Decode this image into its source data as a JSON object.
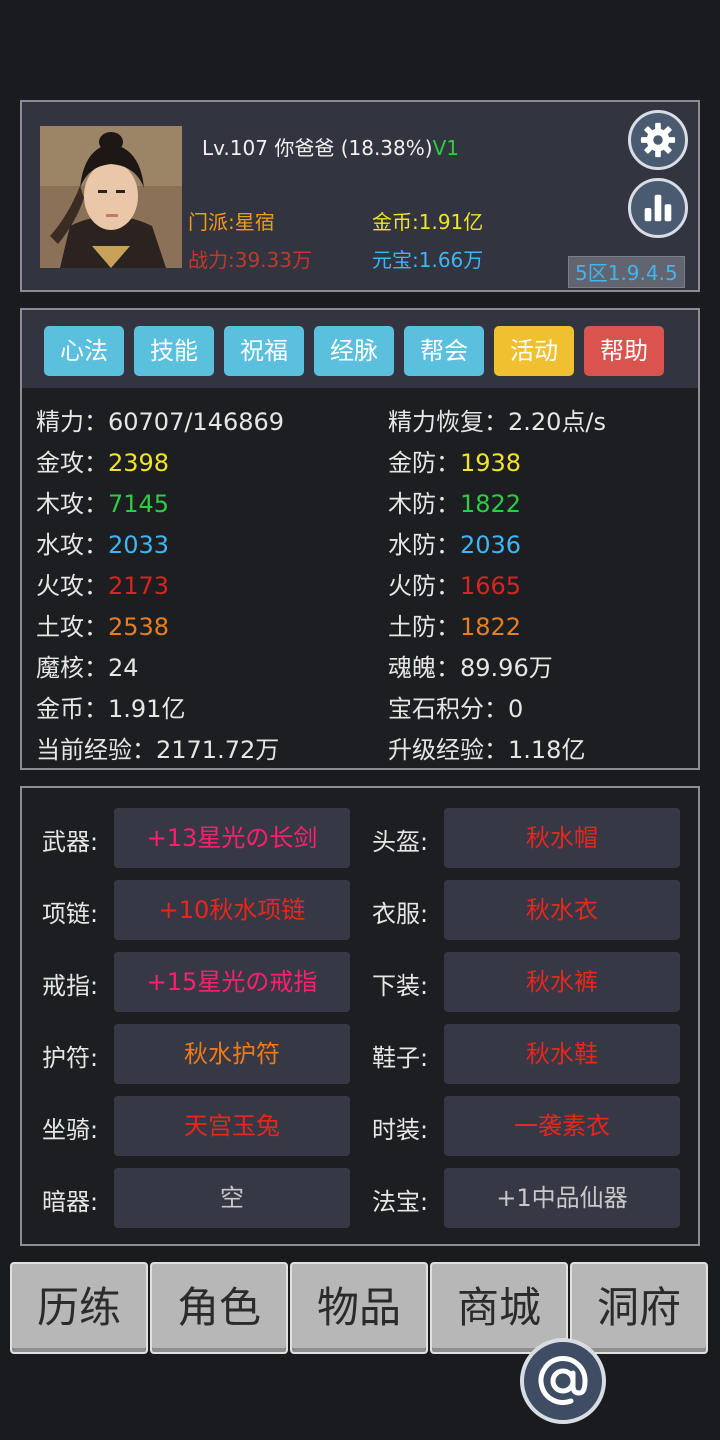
{
  "player": {
    "level": "Lv.107",
    "name": "你爸爸",
    "progress": "(18.38%)",
    "vip": "V1",
    "sect": "门派:星宿",
    "power": "战力:39.33万",
    "gold": "金币:1.91亿",
    "ingot": "元宝:1.66万",
    "version": "5区1.9.4.5"
  },
  "tabs": [
    "心法",
    "技能",
    "祝福",
    "经脉",
    "帮会",
    "活动",
    "帮助"
  ],
  "stats": {
    "energy_label": "精力：",
    "energy_value": "60707/146869",
    "energy_regen_label": "精力恢复：",
    "energy_regen_value": "2.20点/s",
    "metal_atk_label": "金攻：",
    "metal_atk": "2398",
    "metal_def_label": "金防：",
    "metal_def": "1938",
    "wood_atk_label": "木攻：",
    "wood_atk": "7145",
    "wood_def_label": "木防：",
    "wood_def": "1822",
    "water_atk_label": "水攻：",
    "water_atk": "2033",
    "water_def_label": "水防：",
    "water_def": "2036",
    "fire_atk_label": "火攻：",
    "fire_atk": "2173",
    "fire_def_label": "火防：",
    "fire_def": "1665",
    "earth_atk_label": "土攻：",
    "earth_atk": "2538",
    "earth_def_label": "土防：",
    "earth_def": "1822",
    "core_label": "魔核：",
    "core": "24",
    "soul_label": "魂魄：",
    "soul": "89.96万",
    "gold_label": "金币：",
    "gold": "1.91亿",
    "gem_label": "宝石积分：",
    "gem": "0",
    "exp_label": "当前经验：",
    "exp": "2171.72万",
    "next_exp_label": "升级经验：",
    "next_exp": "1.18亿"
  },
  "equipment": {
    "weapon_label": "武器:",
    "weapon": "+13星光の长剑",
    "helmet_label": "头盔:",
    "helmet": "秋水帽",
    "necklace_label": "项链:",
    "necklace": "+10秋水项链",
    "armor_label": "衣服:",
    "armor": "秋水衣",
    "ring_label": "戒指:",
    "ring": "+15星光の戒指",
    "pants_label": "下装:",
    "pants": "秋水裤",
    "amulet_label": "护符:",
    "amulet": "秋水护符",
    "shoes_label": "鞋子:",
    "shoes": "秋水鞋",
    "mount_label": "坐骑:",
    "mount": "天宫玉兔",
    "fashion_label": "时装:",
    "fashion": "一袭素衣",
    "hidden_weapon_label": "暗器:",
    "hidden_weapon": "空",
    "artifact_label": "法宝:",
    "artifact": "+1中品仙器"
  },
  "nav": [
    "历练",
    "角色",
    "物品",
    "商城",
    "洞府"
  ],
  "icons": {
    "settings": "gear-icon",
    "ranking": "bar-chart-icon",
    "chat": "at-sign-icon"
  },
  "colors": {
    "tab_blue": "#5bc0de",
    "tab_yellow": "#f0c030",
    "tab_red": "#d9534f",
    "legendary": "#ff1f6b",
    "epic": "#e8261c",
    "rare": "#f07a18"
  }
}
